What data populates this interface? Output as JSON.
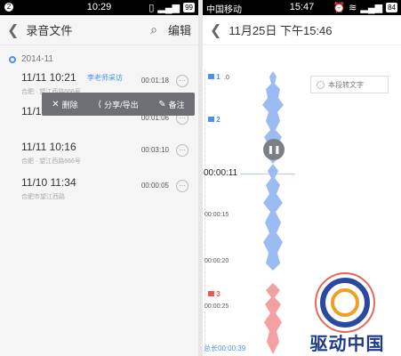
{
  "left": {
    "statusbar": {
      "time": "10:29",
      "battery": "99",
      "notif": "2"
    },
    "header": {
      "title": "录音文件",
      "edit": "编辑"
    },
    "section": {
      "label": "2014-11"
    },
    "records": [
      {
        "time": "11/11 10:21",
        "tag": "李老师采访",
        "loc": "合肥 · 望江西路666号",
        "dur": "00:01:18"
      },
      {
        "time": "11/1",
        "tag": "",
        "loc": "",
        "dur": "00:01:06"
      },
      {
        "time": "11/11 10:16",
        "tag": "",
        "loc": "合肥 · 望江西路666号",
        "dur": "00:03:10"
      },
      {
        "time": "11/10 11:34",
        "tag": "",
        "loc": "合肥市望江西路",
        "dur": "00:00:05"
      }
    ],
    "menu": {
      "delete": "删除",
      "share": "分享/导出",
      "note": "备注"
    }
  },
  "right": {
    "statusbar": {
      "carrier": "中国移动",
      "time": "15:47",
      "battery": "84"
    },
    "header": {
      "title": "11月25日 下午15:46"
    },
    "flags": [
      {
        "num": "1"
      },
      {
        "num": "2"
      },
      {
        "num": "3"
      }
    ],
    "ticks": {
      "t0": ".0",
      "t1": "00:00:15",
      "t2": "00:00:20",
      "t3": "00:00:25"
    },
    "current_time": "00:00:11",
    "to_text": "本段转文字",
    "total": "总长00:00:39",
    "watermark": "驱动中国"
  },
  "colors": {
    "accent": "#4b8ff1",
    "flag_red": "#e55555",
    "wave_blue": "#9bbcf2",
    "wave_red": "#f2a0a0"
  }
}
